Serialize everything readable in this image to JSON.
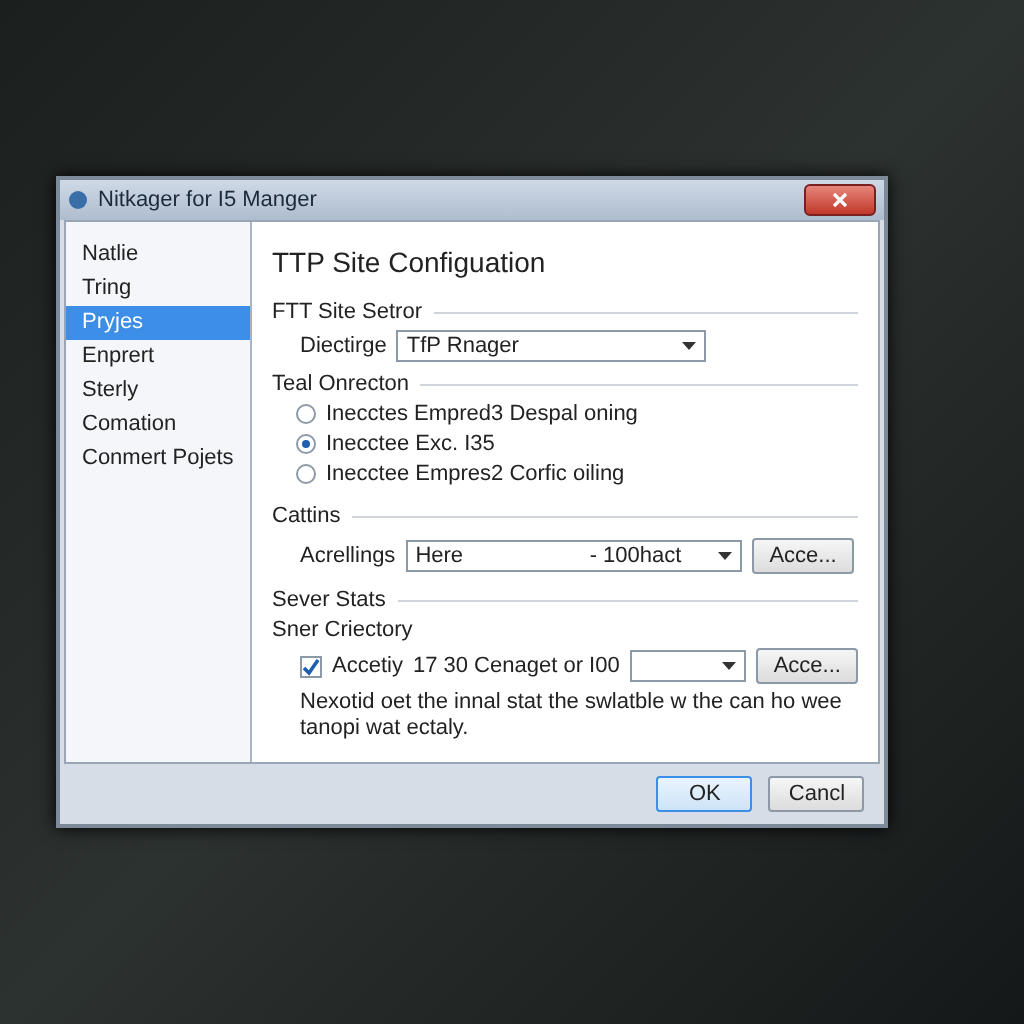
{
  "window": {
    "title": "Nitkager for I5 Manger"
  },
  "sidebar": {
    "items": [
      {
        "label": "Natlie",
        "selected": false
      },
      {
        "label": "Tring",
        "selected": false
      },
      {
        "label": "Pryjes",
        "selected": true
      },
      {
        "label": "Enprert",
        "selected": false
      },
      {
        "label": "Sterly",
        "selected": false
      },
      {
        "label": "Comation",
        "selected": false
      },
      {
        "label": "Conmert Pojets",
        "selected": false
      }
    ]
  },
  "heading": "TTP Site Configuation",
  "site_sector": {
    "title": "FTT Site Setror",
    "label": "Diectirge",
    "value": "TfP Rnager"
  },
  "test_connection": {
    "title": "Teal Onrecton",
    "options": [
      {
        "label": "Inecctes Empred3 Despal oning",
        "selected": false
      },
      {
        "label": "Inecctee Exc. I35",
        "selected": true
      },
      {
        "label": "Inecctee Empres2 Corfic oiling",
        "selected": false
      }
    ]
  },
  "cattins": {
    "title": "Cattins",
    "label": "Acrellings",
    "value": "Here",
    "value_2": "- 100hact",
    "button": "Acce..."
  },
  "server_stats": {
    "title": "Sever Stats",
    "subtitle": "Sner Criectory",
    "checkbox_label": "Accetiy",
    "checked": true,
    "value": "17 30 Cenaget or I00",
    "button": "Acce...",
    "note": "Nexotid oet the innal stat the swlatble w the can ho wee tanopi wat ectaly."
  },
  "buttons": [
    {
      "label": "OK",
      "default": true
    },
    {
      "label": "Cancl",
      "default": false
    }
  ]
}
